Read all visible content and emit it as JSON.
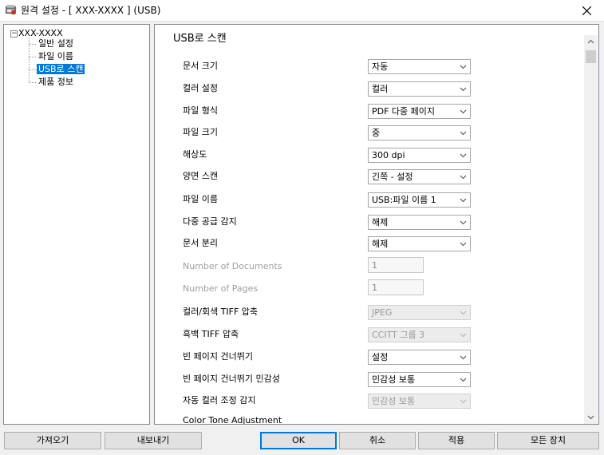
{
  "window": {
    "title": "원격 설정 - [ XXX-XXXX ] (USB)"
  },
  "tree": {
    "root": "XXX-XXXX",
    "items": [
      {
        "label": "일반 설정"
      },
      {
        "label": "파일 이름"
      },
      {
        "label": "USB로 스캔",
        "selected": true
      },
      {
        "label": "제품 정보"
      }
    ]
  },
  "panel": {
    "section_title": "USB로 스캔",
    "settings": [
      {
        "label": "문서 크기",
        "type": "select",
        "value": "자동"
      },
      {
        "label": "컬러 설정",
        "type": "select",
        "value": "컬러"
      },
      {
        "label": "파일 형식",
        "type": "select",
        "value": "PDF 다중 페이지"
      },
      {
        "label": "파일 크기",
        "type": "select",
        "value": "중"
      },
      {
        "label": "해상도",
        "type": "select",
        "value": "300 dpi"
      },
      {
        "label": "양면 스캔",
        "type": "select",
        "value": "긴쪽 - 설정"
      },
      {
        "label": "파일 이름",
        "type": "select",
        "value": "USB:파일 이름 1"
      },
      {
        "label": "다중 공급 감지",
        "type": "select",
        "value": "해제"
      },
      {
        "label": "문서 분리",
        "type": "select",
        "value": "해제"
      },
      {
        "label": "Number of Documents",
        "type": "text",
        "value": "1",
        "disabled": true
      },
      {
        "label": "Number of Pages",
        "type": "text",
        "value": "1",
        "disabled": true
      },
      {
        "label": "컬러/회색 TIFF 압축",
        "type": "select",
        "value": "JPEG",
        "disabled": true
      },
      {
        "label": "흑백 TIFF 압축",
        "type": "select",
        "value": "CCITT 그룹 3",
        "disabled": true
      },
      {
        "label": "빈 페이지 건너뛰기",
        "type": "select",
        "value": "설정"
      },
      {
        "label": "빈 페이지 건너뛰기 민감성",
        "type": "select",
        "value": "민감성 보통"
      },
      {
        "label": "자동 컬러 조정 감지",
        "type": "select",
        "value": "민감성 보통",
        "disabled": true
      },
      {
        "label": "Color Tone Adjustment",
        "type": "none"
      }
    ]
  },
  "buttons": {
    "import": "가져오기",
    "export": "내보내기",
    "ok": "OK",
    "cancel": "취소",
    "apply": "적용",
    "all_devices": "모든 장치"
  },
  "colors": {
    "selection": "#0078d7",
    "default_button_border": "#0078d7"
  },
  "icons": {
    "app": "remote-setup-app-icon",
    "close": "close-icon",
    "chevron": "chevron-down-icon",
    "expander": "collapse-minus-icon"
  }
}
